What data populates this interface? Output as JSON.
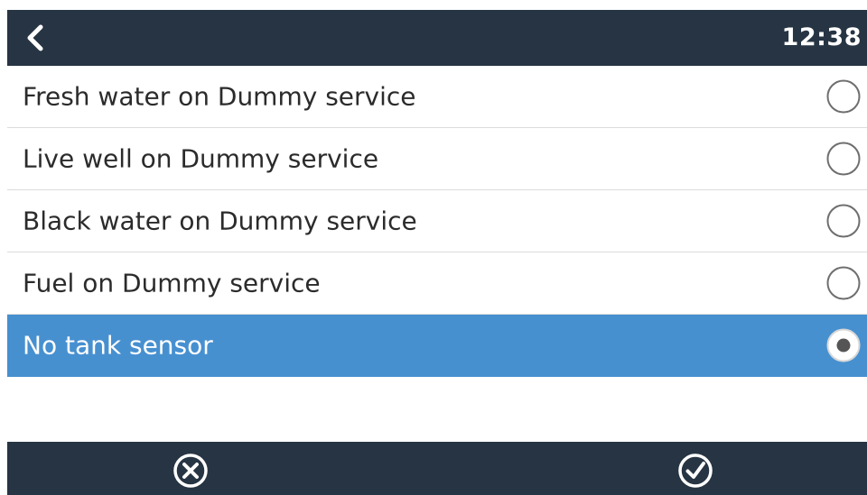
{
  "header": {
    "back_icon": "chevron-left-icon",
    "clock": "12:38"
  },
  "list": {
    "items": [
      {
        "label": "Fresh water on Dummy service",
        "selected": false
      },
      {
        "label": "Live well on Dummy service",
        "selected": false
      },
      {
        "label": "Black water on Dummy service",
        "selected": false
      },
      {
        "label": "Fuel on Dummy service",
        "selected": false
      },
      {
        "label": "No tank sensor",
        "selected": true
      }
    ]
  },
  "footer": {
    "cancel_icon": "circle-x-icon",
    "confirm_icon": "circle-check-icon"
  },
  "colors": {
    "bar": "#263443",
    "selected_row": "#4790d0",
    "divider": "#dcdcdc",
    "text": "#2b2b2b"
  }
}
